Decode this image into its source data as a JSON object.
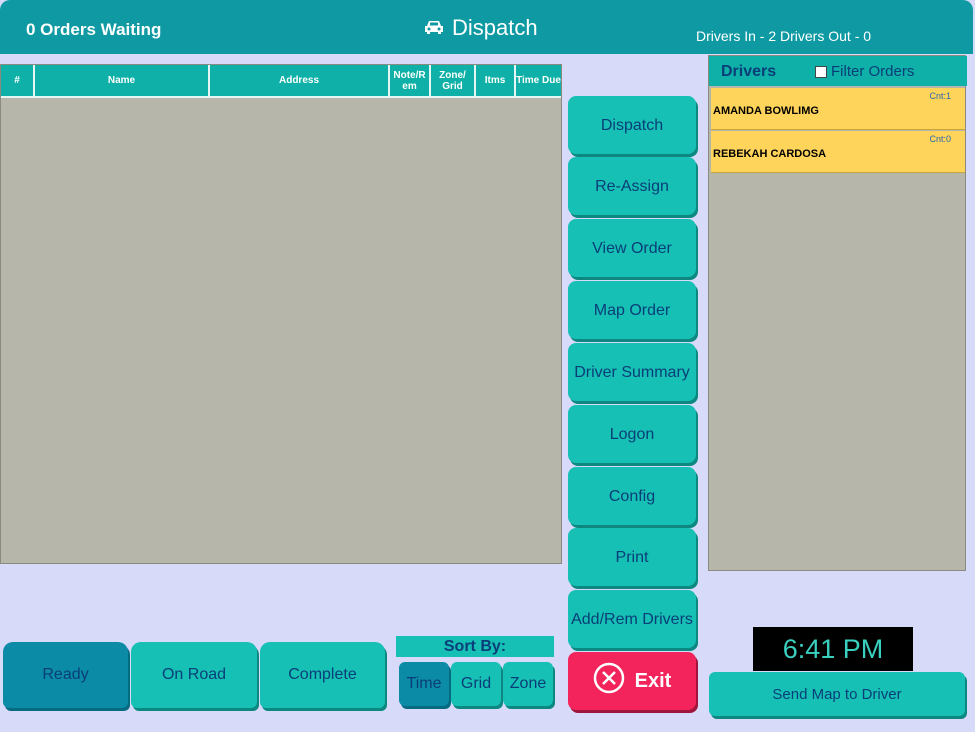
{
  "header": {
    "orders_waiting": "0 Orders Waiting",
    "title": "Dispatch",
    "title_icon": "car-icon",
    "drivers_status": "Drivers In - 2  Drivers Out - 0"
  },
  "orders_table": {
    "columns": [
      "#",
      "Name",
      "Address",
      "Note/R em",
      "Zone/ Grid",
      "Itms",
      "Time Due"
    ],
    "rows": []
  },
  "actions": {
    "dispatch": "Dispatch",
    "reassign": "Re-Assign",
    "view_order": "View Order",
    "map_order": "Map Order",
    "driver_summary": "Driver Summary",
    "logon": "Logon",
    "config": "Config",
    "print": "Print",
    "add_rem_drivers": "Add/Rem Drivers",
    "exit": "Exit"
  },
  "drivers_panel": {
    "label": "Drivers",
    "filter_label": "Filter Orders",
    "filter_checked": false,
    "drivers": [
      {
        "name": "AMANDA BOWLIMG",
        "count": "Cnt:1"
      },
      {
        "name": "REBEKAH  CARDOSA",
        "count": "Cnt:0"
      }
    ]
  },
  "clock": "6:41 PM",
  "send_map": "Send Map to Driver",
  "status_buttons": {
    "ready": "Ready",
    "on_road": "On Road",
    "complete": "Complete",
    "selected": "ready"
  },
  "sort": {
    "label": "Sort By:",
    "time": "Time",
    "grid": "Grid",
    "zone": "Zone",
    "selected": "time"
  },
  "colors": {
    "accent": "#16c0b4",
    "header": "#0f9aa3",
    "exit": "#f3245b",
    "driver_card": "#ffd45a"
  }
}
